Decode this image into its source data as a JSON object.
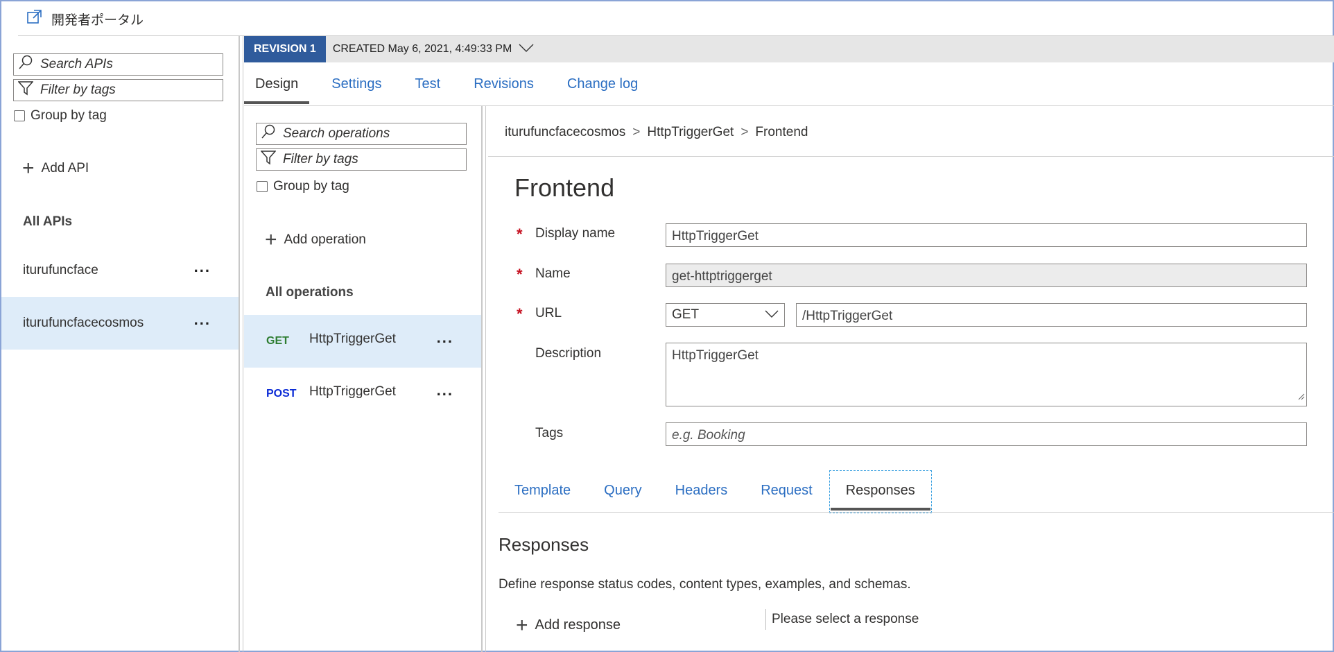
{
  "top": {
    "portal_label": "開発者ポータル"
  },
  "api_pane": {
    "search_placeholder": "Search APIs",
    "filter_placeholder": "Filter by tags",
    "group_by_tag": "Group by tag",
    "add_api": "Add API",
    "all_apis": "All APIs",
    "apis": [
      {
        "name": "iturufuncface",
        "more": "..."
      },
      {
        "name": "iturufuncfacecosmos",
        "more": "..."
      }
    ]
  },
  "revision": {
    "badge": "REVISION 1",
    "created": "CREATED May 6, 2021, 4:49:33 PM"
  },
  "main_tabs": [
    "Design",
    "Settings",
    "Test",
    "Revisions",
    "Change log"
  ],
  "ops_pane": {
    "search_placeholder": "Search operations",
    "filter_placeholder": "Filter by tags",
    "group_by_tag": "Group by tag",
    "add_operation": "Add operation",
    "all_operations": "All operations",
    "operations": [
      {
        "method": "GET",
        "name": "HttpTriggerGet",
        "more": "...",
        "color": "#2e7d32"
      },
      {
        "method": "POST",
        "name": "HttpTriggerGet",
        "more": "...",
        "color": "#0b2bd6"
      }
    ]
  },
  "breadcrumb": [
    "iturufuncfacecosmos",
    ">",
    "HttpTriggerGet",
    ">",
    "Frontend"
  ],
  "frontend": {
    "title": "Frontend",
    "display_name_label": "Display name",
    "display_name_value": "HttpTriggerGet",
    "name_label": "Name",
    "name_value": "get-httptriggerget",
    "url_label": "URL",
    "url_method": "GET",
    "url_value": "/HttpTriggerGet",
    "description_label": "Description",
    "description_value": "HttpTriggerGet",
    "tags_label": "Tags",
    "tags_placeholder": "e.g. Booking",
    "required_mark": "*"
  },
  "sub_tabs": [
    "Template",
    "Query",
    "Headers",
    "Request",
    "Responses"
  ],
  "responses": {
    "heading": "Responses",
    "description": "Define response status codes, content types, examples, and schemas.",
    "add_response": "Add response",
    "please_select": "Please select a response"
  }
}
